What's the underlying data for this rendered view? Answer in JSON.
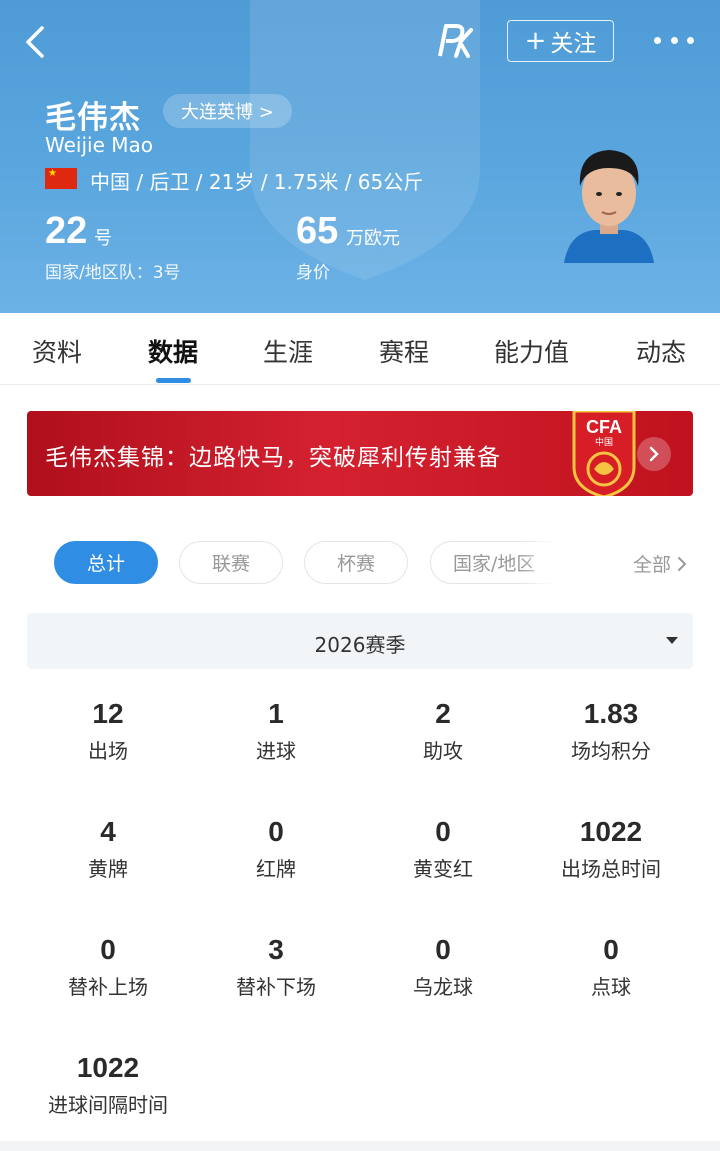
{
  "header": {
    "follow_label": "关注",
    "player_name": "毛伟杰",
    "team": "大连英博 >",
    "name_en": "Weijie Mao",
    "bio": "中国 / 后卫 / 21岁 / 1.75米 / 65公斤",
    "number": "22",
    "number_unit": "号",
    "national_team": "国家/地区队：3号",
    "value": "65",
    "value_unit": "万欧元",
    "value_label": "身价",
    "bg_color": "#5aa6de"
  },
  "tabs": [
    {
      "label": "资料"
    },
    {
      "label": "数据",
      "active": true
    },
    {
      "label": "生涯"
    },
    {
      "label": "赛程"
    },
    {
      "label": "能力值"
    },
    {
      "label": "动态"
    }
  ],
  "banner": {
    "text": "毛伟杰集锦：边路快马，突破犀利传射兼备",
    "badge_text": "CFA",
    "badge_sub": "中国"
  },
  "filters": {
    "chips": [
      {
        "label": "总计",
        "active": true
      },
      {
        "label": "联赛"
      },
      {
        "label": "杯赛"
      },
      {
        "label": "国家/地区"
      }
    ],
    "all_label": "全部"
  },
  "season": {
    "label": "2026赛季"
  },
  "stats": [
    {
      "value": "12",
      "label": "出场"
    },
    {
      "value": "1",
      "label": "进球"
    },
    {
      "value": "2",
      "label": "助攻"
    },
    {
      "value": "1.83",
      "label": "场均积分"
    },
    {
      "value": "4",
      "label": "黄牌"
    },
    {
      "value": "0",
      "label": "红牌"
    },
    {
      "value": "0",
      "label": "黄变红"
    },
    {
      "value": "1022",
      "label": "出场总时间"
    },
    {
      "value": "0",
      "label": "替补上场"
    },
    {
      "value": "3",
      "label": "替补下场"
    },
    {
      "value": "0",
      "label": "乌龙球"
    },
    {
      "value": "0",
      "label": "点球"
    },
    {
      "value": "1022",
      "label": "进球间隔时间"
    }
  ],
  "colors": {
    "accent": "#2f8de4",
    "banner_red": "#c8141f"
  }
}
